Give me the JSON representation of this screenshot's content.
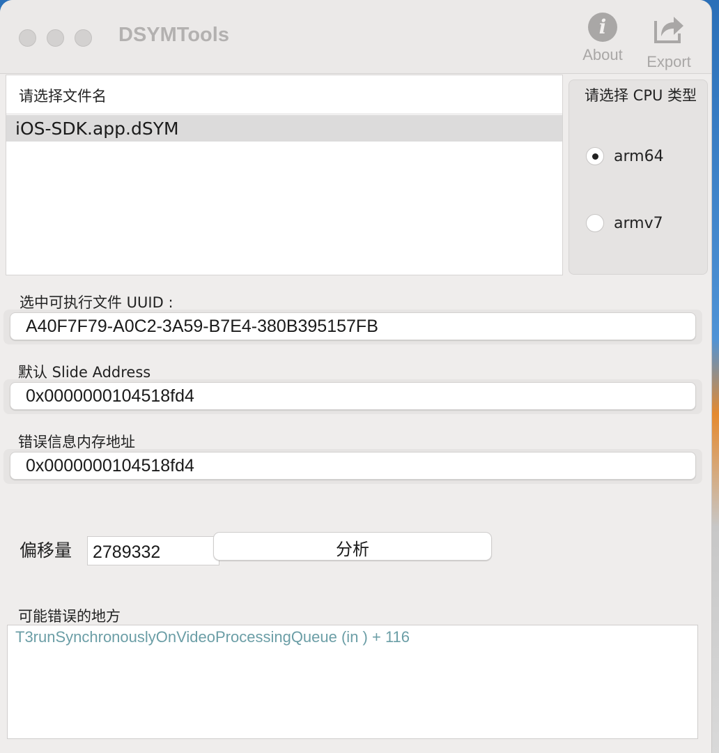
{
  "window": {
    "title": "DSYMTools"
  },
  "toolbar": {
    "about_label": "About",
    "export_label": "Export"
  },
  "file_list": {
    "header": "请选择文件名",
    "items": [
      "iOS-SDK.app.dSYM"
    ]
  },
  "cpu": {
    "title": "请选择 CPU 类型",
    "options": [
      {
        "label": "arm64",
        "selected": true
      },
      {
        "label": "armv7",
        "selected": false
      }
    ]
  },
  "uuid": {
    "label": "选中可执行文件 UUID :",
    "value": "A40F7F79-A0C2-3A59-B7E4-380B395157FB"
  },
  "slide": {
    "label": "默认 Slide Address",
    "value": "0x0000000104518fd4"
  },
  "error_addr": {
    "label": "错误信息内存地址",
    "value": "0x0000000104518fd4"
  },
  "offset": {
    "label": "偏移量",
    "value": "2789332",
    "button": "分析"
  },
  "result": {
    "label": "可能错误的地方",
    "text": "T3runSynchronouslyOnVideoProcessingQueue (in ) + 116"
  }
}
